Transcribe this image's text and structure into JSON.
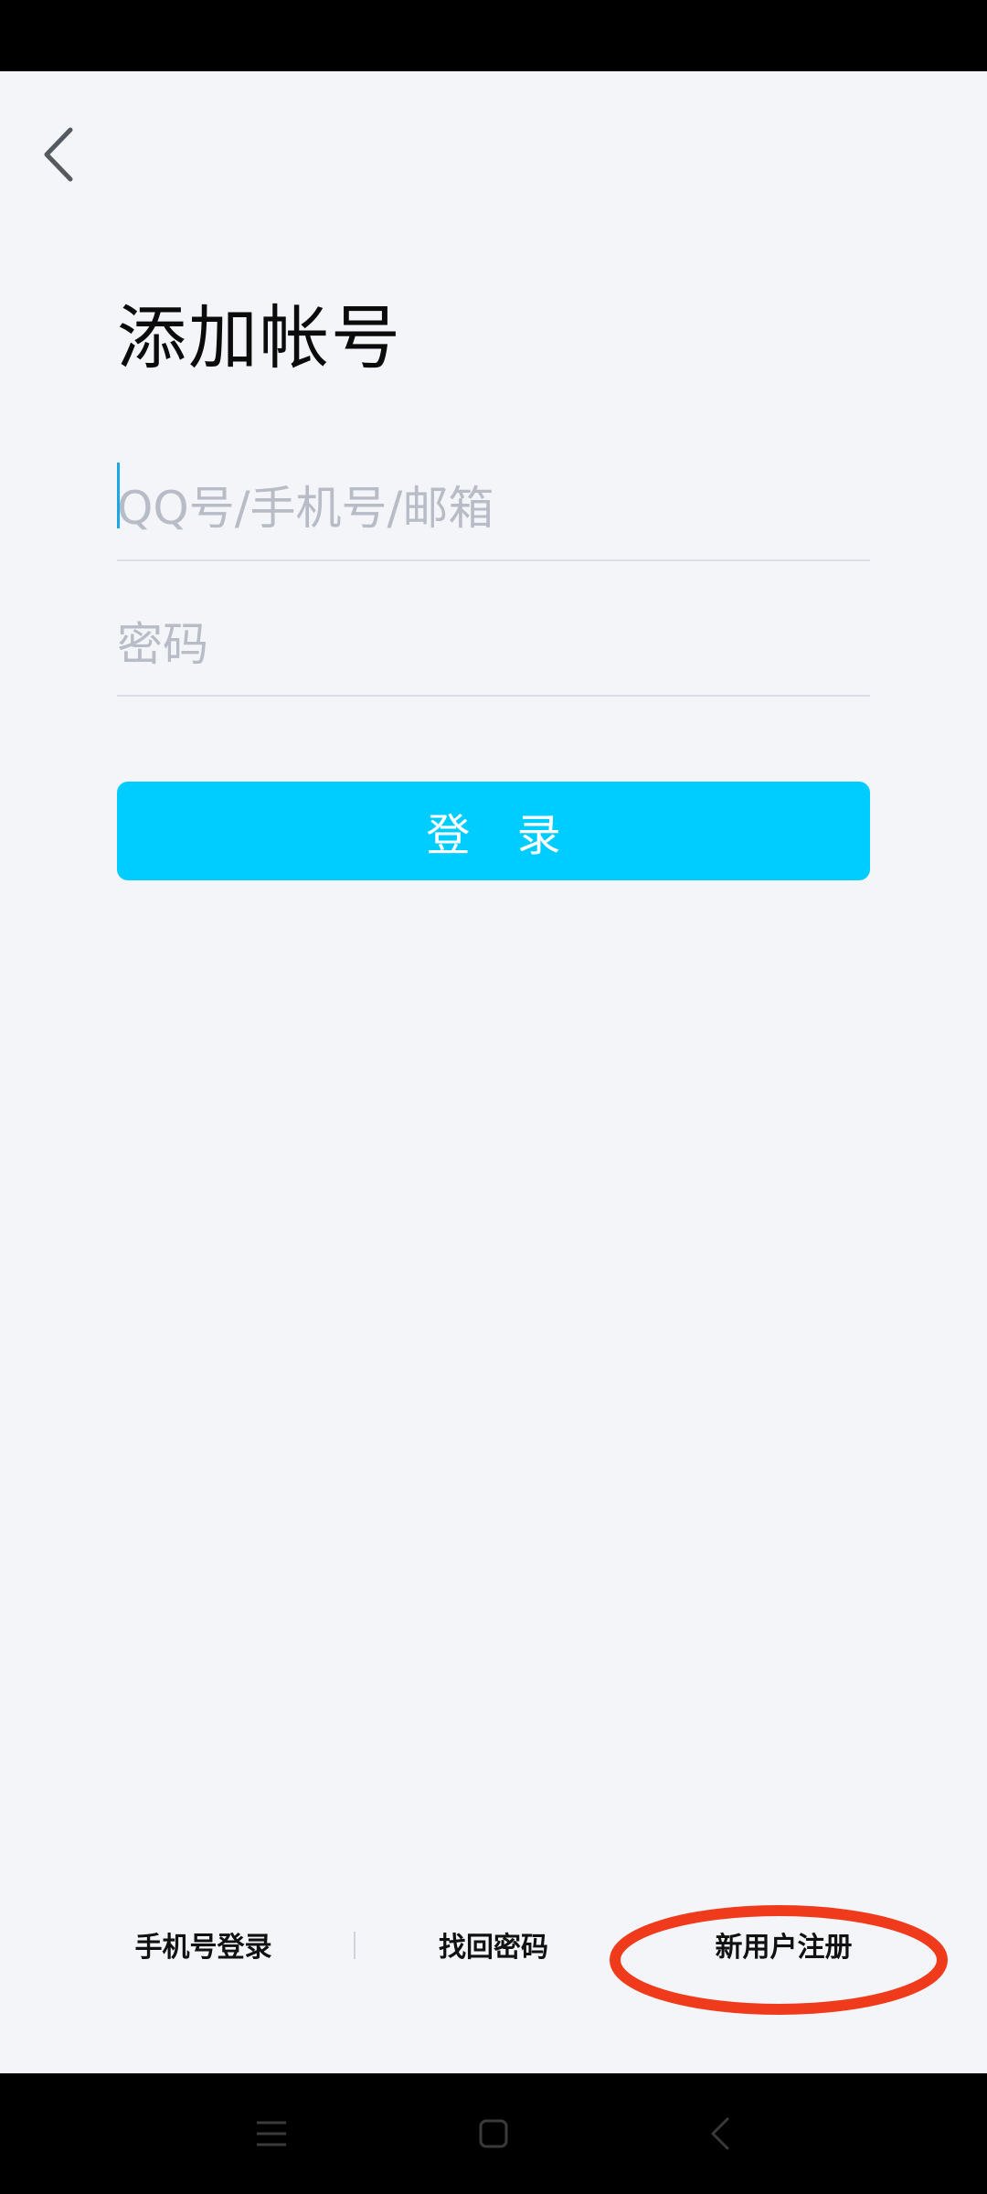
{
  "header": {
    "back_icon": "chevron-left-icon"
  },
  "title": "添加帐号",
  "form": {
    "account_placeholder": "QQ号/手机号/邮箱",
    "password_placeholder": "密码",
    "login_label": "登 录"
  },
  "footer_links": {
    "phone_login": "手机号登录",
    "forgot_password": "找回密码",
    "register": "新用户注册"
  },
  "annotation": {
    "highlight_color": "#f03a1c"
  },
  "nav_bar": {
    "menu_icon": "menu-icon",
    "home_icon": "home-square-icon",
    "back_icon": "back-triangle-icon"
  },
  "colors": {
    "accent": "#00cdff",
    "background": "#f3f5f9",
    "caret": "#1aa7e8"
  }
}
